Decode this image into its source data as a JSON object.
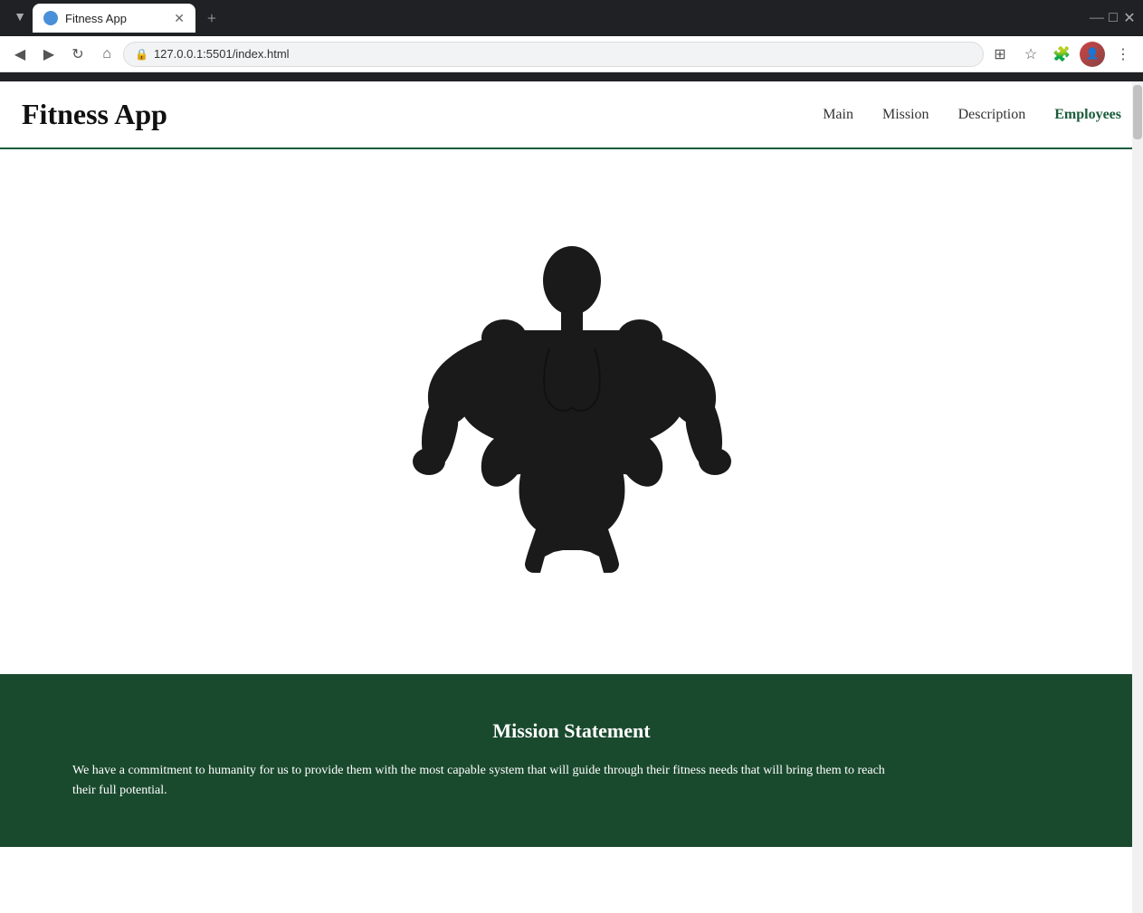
{
  "browser": {
    "tab_title": "Fitness App",
    "url": "127.0.0.1:5501/index.html",
    "new_tab_label": "+",
    "back_icon": "◀",
    "forward_icon": "▶",
    "reload_icon": "↻",
    "home_icon": "⌂",
    "secure_icon": "🔒",
    "minimize_icon": "—",
    "maximize_icon": "□",
    "close_icon": "✕",
    "tab_close": "✕"
  },
  "nav": {
    "logo": "Fitness App",
    "links": [
      {
        "label": "Main",
        "active": false
      },
      {
        "label": "Mission",
        "active": false
      },
      {
        "label": "Description",
        "active": false
      },
      {
        "label": "Employees",
        "active": true
      }
    ]
  },
  "mission": {
    "title": "Mission Statement",
    "text": "We have a commitment to humanity for us to provide them with the most capable system that will guide through their fitness needs that will bring them to reach their full potential."
  }
}
